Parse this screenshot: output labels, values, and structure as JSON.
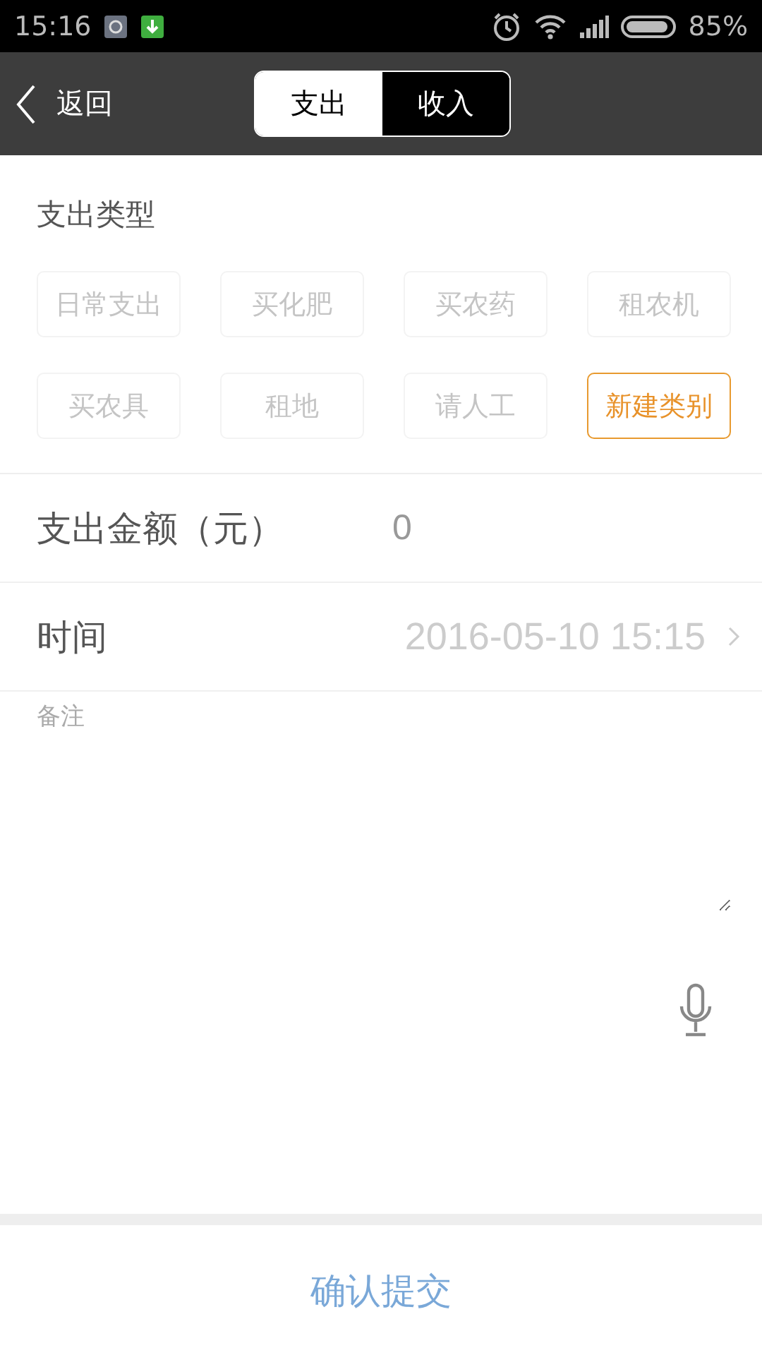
{
  "status_bar": {
    "time": "15:16",
    "battery": "85%"
  },
  "nav": {
    "back": "返回",
    "tabs": [
      {
        "label": "支出",
        "selected": true
      },
      {
        "label": "收入",
        "selected": false
      }
    ]
  },
  "category_section": {
    "title": "支出类型",
    "categories": [
      {
        "label": "日常支出",
        "kind": "preset"
      },
      {
        "label": "买化肥",
        "kind": "preset"
      },
      {
        "label": "买农药",
        "kind": "preset"
      },
      {
        "label": "租农机",
        "kind": "preset"
      },
      {
        "label": "买农具",
        "kind": "preset"
      },
      {
        "label": "租地",
        "kind": "preset"
      },
      {
        "label": "请人工",
        "kind": "preset"
      },
      {
        "label": "新建类别",
        "kind": "new"
      }
    ]
  },
  "amount": {
    "label": "支出金额（元）",
    "value": "0"
  },
  "time": {
    "label": "时间",
    "value": "2016-05-10 15:15"
  },
  "note": {
    "placeholder": "备注"
  },
  "submit": "确认提交"
}
